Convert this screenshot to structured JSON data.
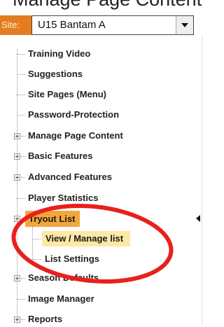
{
  "header_clip_text": "Manage Page Content",
  "site": {
    "label": "Site:",
    "value": "U15 Bantam A"
  },
  "tree": {
    "items": [
      {
        "label": "Training Video"
      },
      {
        "label": "Suggestions"
      },
      {
        "label": "Site Pages (Menu)"
      },
      {
        "label": "Password-Protection"
      },
      {
        "label": "Manage Page Content"
      },
      {
        "label": "Basic Features"
      },
      {
        "label": "Advanced Features"
      },
      {
        "label": "Player Statistics"
      },
      {
        "label": "Tryout List"
      },
      {
        "label": "View / Manage list"
      },
      {
        "label": "List Settings"
      },
      {
        "label": "Season Defaults"
      },
      {
        "label": "Image Manager"
      },
      {
        "label": "Reports"
      }
    ]
  },
  "colors": {
    "site_label_bg": "#e47c20",
    "selected_bg": "#f3a63c",
    "subselected_bg": "#fde9a6",
    "annotation_red": "#e8201c"
  }
}
